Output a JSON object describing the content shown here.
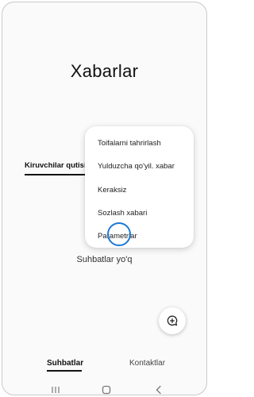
{
  "app": {
    "title": "Xabarlar"
  },
  "conversation_tab": {
    "label": "Kiruvchilar qutisi"
  },
  "empty_state": {
    "text": "Suhbatlar yo'q"
  },
  "menu": {
    "items": [
      {
        "label": "Toifalarni tahrirlash"
      },
      {
        "label": "Yulduzcha qo'yil. xabar"
      },
      {
        "label": "Keraksiz"
      },
      {
        "label": "Sozlash xabari"
      },
      {
        "label": "Parametrlar"
      }
    ]
  },
  "fab": {
    "icon": "new-chat-icon"
  },
  "bottom_tabs": [
    {
      "label": "Suhbatlar",
      "active": true
    },
    {
      "label": "Kontaktlar",
      "active": false
    }
  ],
  "nav": {
    "recent_icon": "recent-apps-icon",
    "home_icon": "home-icon",
    "back_icon": "back-icon"
  },
  "colors": {
    "highlight": "#1e78d6"
  }
}
